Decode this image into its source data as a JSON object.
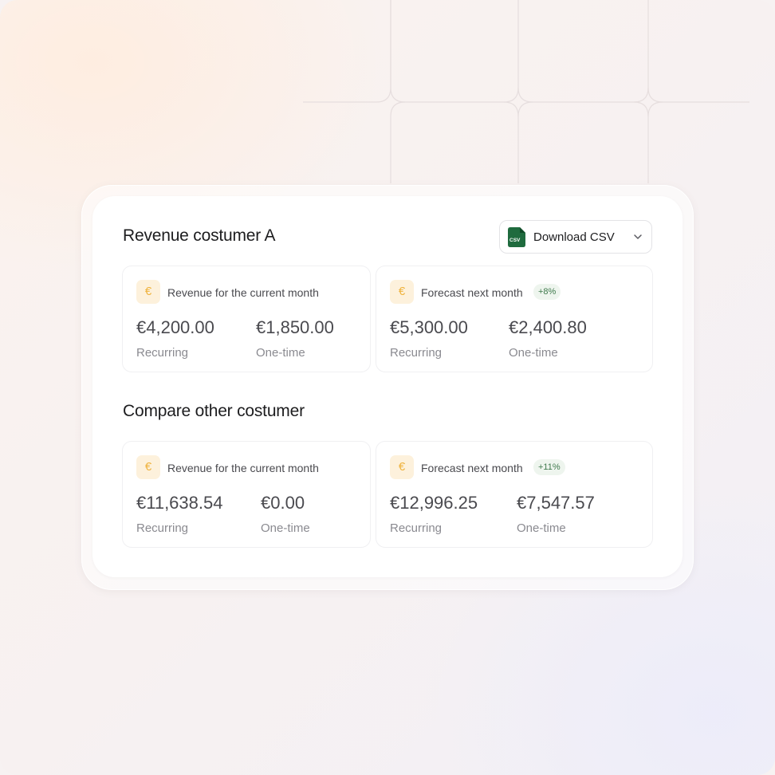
{
  "colors": {
    "accent_euro": "#efb23c",
    "euro_badge_bg": "#fdf1dc",
    "trend_bg": "#eef5ee",
    "trend_text": "#3f7a4d",
    "csv_icon_green": "#1f6b3e"
  },
  "header": {
    "title": "Revenue costumer A",
    "download_button": {
      "label": "Download CSV",
      "icon_text": "CSV",
      "icon": "csv-file-icon",
      "chevron": "chevron-down-icon"
    }
  },
  "customer_a": {
    "current": {
      "currency_symbol": "€",
      "label": "Revenue for the current month",
      "recurring_value": "€4,200.00",
      "recurring_label": "Recurring",
      "onetime_value": "€1,850.00",
      "onetime_label": "One-time"
    },
    "forecast": {
      "currency_symbol": "€",
      "label": "Forecast next month",
      "trend": "+8%",
      "recurring_value": "€5,300.00",
      "recurring_label": "Recurring",
      "onetime_value": "€2,400.80",
      "onetime_label": "One-time"
    }
  },
  "compare": {
    "title": "Compare other costumer",
    "current": {
      "currency_symbol": "€",
      "label": "Revenue for the current month",
      "recurring_value": "€11,638.54",
      "recurring_label": "Recurring",
      "onetime_value": "€0.00",
      "onetime_label": "One-time"
    },
    "forecast": {
      "currency_symbol": "€",
      "label": "Forecast next month",
      "trend": "+11%",
      "recurring_value": "€12,996.25",
      "recurring_label": "Recurring",
      "onetime_value": "€7,547.57",
      "onetime_label": "One-time"
    }
  }
}
